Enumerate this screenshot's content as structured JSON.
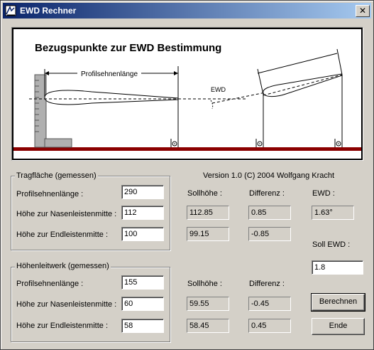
{
  "window": {
    "title": "EWD Rechner",
    "close_glyph": "✕",
    "icon": "calculator-app-icon"
  },
  "diagram": {
    "title": "Bezugspunkte zur EWD Bestimmung",
    "chord_label": "Profilsehnenlänge",
    "ewd_label": "EWD"
  },
  "version_text": "Version 1.0  (C) 2004 Wolfgang Kracht",
  "wing": {
    "group_title": "Tragfläche (gemessen)",
    "rows": [
      {
        "label": "Profilsehnenlänge :",
        "value": "290"
      },
      {
        "label": "Höhe zur Nasenleistenmitte :",
        "value": "112"
      },
      {
        "label": "Höhe zur Endleistenmitte :",
        "value": "100"
      }
    ],
    "sollhoehe_header": "Sollhöhe :",
    "differenz_header": "Differenz :",
    "sollhoehe": [
      "112.85",
      "99.15"
    ],
    "differenz": [
      "0.85",
      "-0.85"
    ]
  },
  "tail": {
    "group_title": "Höhenleitwerk (gemessen)",
    "rows": [
      {
        "label": "Profilsehnenlänge :",
        "value": "155"
      },
      {
        "label": "Höhe zur Nasenleistenmitte :",
        "value": "60"
      },
      {
        "label": "Höhe zur Endleistenmitte :",
        "value": "58"
      }
    ],
    "sollhoehe_header": "Sollhöhe :",
    "differenz_header": "Differenz :",
    "sollhoehe": [
      "59.55",
      "58.45"
    ],
    "differenz": [
      "-0.45",
      "0.45"
    ]
  },
  "ewd": {
    "label": "EWD :",
    "value": "1.63°",
    "soll_label": "Soll EWD :",
    "soll_value": "1.8"
  },
  "buttons": {
    "calculate": "Berechnen",
    "end": "Ende"
  },
  "colors": {
    "title_start": "#0a246a",
    "title_end": "#a6caf0",
    "base_bar": "#8b0000"
  }
}
